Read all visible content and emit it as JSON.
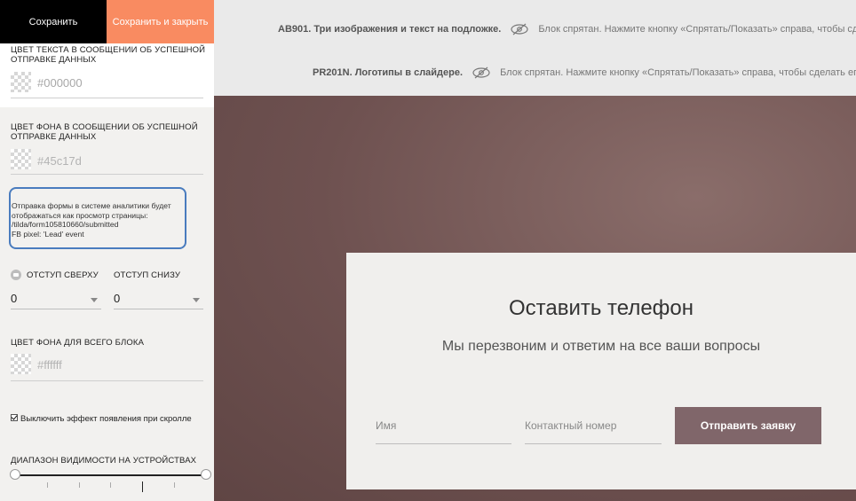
{
  "toolbar": {
    "save_label": "Сохранить",
    "save_close_label": "Сохранить и закрыть"
  },
  "settings": {
    "success_text_color": {
      "label_line1": "ЦВЕТ ТЕКСТА В СООБЩЕНИИ ОБ УСПЕШНОЙ",
      "label_line2": "ОТПРАВКЕ ДАННЫХ",
      "value": "#000000"
    },
    "success_bg_color": {
      "label_line1": "ЦВЕТ ФОНА В СООБЩЕНИИ ОБ УСПЕШНОЙ",
      "label_line2": "ОТПРАВКЕ ДАННЫХ",
      "value": "#45c17d"
    },
    "analytics_info": {
      "line1": "Отправка формы в системе аналитики будет",
      "line2": "отображаться как просмотр страницы:",
      "line3": "/tilda/form105810660/submitted",
      "line4": "FB pixel: 'Lead' event"
    },
    "padding_top": {
      "label": "ОТСТУП СВЕРХУ",
      "value": "0"
    },
    "padding_bottom": {
      "label": "ОТСТУП СНИЗУ",
      "value": "0"
    },
    "block_bg_color": {
      "label": "ЦВЕТ ФОНА ДЛЯ ВСЕГО БЛОКА",
      "value": "#ffffff"
    },
    "scroll_effect": {
      "label": "Выключить эффект появления при скролле",
      "checked": true
    },
    "visibility_range": {
      "label": "ДИАПАЗОН ВИДИМОСТИ НА УСТРОЙСТВАХ"
    }
  },
  "strip": {
    "row1": {
      "code": "AB901. Три изображения и текст на подложке.",
      "message": "Блок спрятан. Нажмите кнопку «Спрятать/Показать» справа, чтобы сделать"
    },
    "row2": {
      "code": "PR201N. Логотипы в слайдере.",
      "message": "Блок спрятан. Нажмите кнопку «Спрятать/Показать» справа, чтобы сделать его ви"
    }
  },
  "form": {
    "title": "Оставить телефон",
    "subtitle": "Мы перезвоним и ответим на все ваши вопросы",
    "name_placeholder": "Имя",
    "phone_placeholder": "Контактный номер",
    "submit_label": "Отправить заявку"
  },
  "colors": {
    "save_bg": "#000000",
    "save_close_bg": "#f98b61",
    "info_border": "#4a7cbe",
    "page_bg": "#6e5150",
    "submit_bg": "#80666a"
  },
  "icons": [
    "eye-crossed-icon",
    "tooltip-icon",
    "chevron-down-icon",
    "checkmark-icon"
  ]
}
